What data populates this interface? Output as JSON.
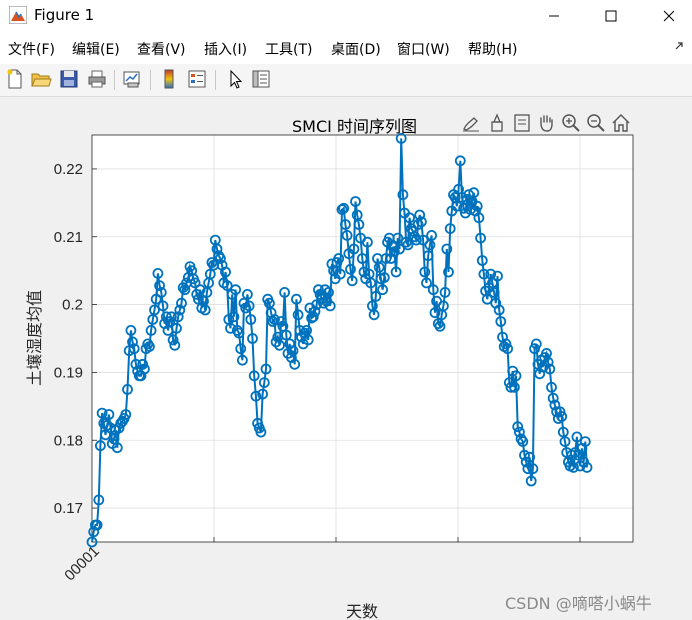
{
  "window": {
    "title": "Figure 1",
    "minimize_label": "—",
    "maximize_label": "☐",
    "close_label": "✕"
  },
  "menu": [
    {
      "label": "文件(F)"
    },
    {
      "label": "编辑(E)"
    },
    {
      "label": "查看(V)"
    },
    {
      "label": "插入(I)"
    },
    {
      "label": "工具(T)"
    },
    {
      "label": "桌面(D)"
    },
    {
      "label": "窗口(W)"
    },
    {
      "label": "帮助(H)"
    }
  ],
  "toolbar_icons": [
    "new-figure-icon",
    "open-file-icon",
    "save-icon",
    "print-icon",
    "link-plot-icon",
    "insert-colorbar-icon",
    "insert-legend-icon",
    "edit-plot-arrow-icon",
    "property-editor-icon"
  ],
  "axes_toolbar_icons": [
    "brush-icon",
    "data-tips-icon",
    "export-icon",
    "pan-hand-icon",
    "zoom-in-icon",
    "zoom-out-icon",
    "home-icon"
  ],
  "watermark": "CSDN @嘀嗒小蜗牛",
  "colors": {
    "series": "#0072BD",
    "axes_bg": "#ffffff",
    "figure_bg": "#f0f0f0",
    "grid": "#dfdfdf"
  },
  "chart_data": {
    "type": "line",
    "title": "SMCI 时间序列图",
    "xlabel": "天数",
    "ylabel": "土壤湿度均值",
    "x_tick_labels": [
      "00001"
    ],
    "ylim": [
      0.165,
      0.225
    ],
    "yticks": [
      0.17,
      0.18,
      0.19,
      0.2,
      0.21,
      0.22
    ],
    "ytick_labels": [
      "0.17",
      "0.18",
      "0.19",
      "0.2",
      "0.21",
      "0.22"
    ],
    "grid": true,
    "marker": "circle",
    "series": [
      {
        "values": [
          0.165,
          0.1665,
          0.1675,
          0.1675,
          0.1712,
          0.1792,
          0.184,
          0.1825,
          0.1808,
          0.1822,
          0.1838,
          0.1818,
          0.1795,
          0.1802,
          0.1815,
          0.1789,
          0.1818,
          0.1825,
          0.1828,
          0.1832,
          0.1838,
          0.1875,
          0.1932,
          0.1962,
          0.1945,
          0.1935,
          0.1912,
          0.1902,
          0.1895,
          0.1895,
          0.1912,
          0.1905,
          0.1935,
          0.1942,
          0.1938,
          0.1962,
          0.1978,
          0.1992,
          0.2008,
          0.2046,
          0.2028,
          0.2018,
          0.1998,
          0.1972,
          0.1982,
          0.1962,
          0.1975,
          0.1982,
          0.1948,
          0.194,
          0.1965,
          0.1982,
          0.1992,
          0.2002,
          0.2025,
          0.2022,
          0.2032,
          0.204,
          0.2056,
          0.205,
          0.2038,
          0.2032,
          0.2015,
          0.2008,
          0.2022,
          0.1995,
          0.2005,
          0.1992,
          0.2018,
          0.2032,
          0.2045,
          0.2062,
          0.2058,
          0.2095,
          0.2082,
          0.2072,
          0.2068,
          0.2058,
          0.2032,
          0.2048,
          0.2028,
          0.1978,
          0.1965,
          0.2015,
          0.1982,
          0.2022,
          0.1962,
          0.1958,
          0.1935,
          0.1918,
          0.2002,
          0.1995,
          0.2015,
          0.1998,
          0.1978,
          0.195,
          0.1895,
          0.1865,
          0.1825,
          0.1818,
          0.1812,
          0.1868,
          0.1885,
          0.1905,
          0.2008,
          0.2002,
          0.1988,
          0.1975,
          0.1978,
          0.1945,
          0.1952,
          0.194,
          0.1975,
          0.1968,
          0.2018,
          0.1955,
          0.1928,
          0.1942,
          0.1922,
          0.1932,
          0.1912,
          0.2008,
          0.1985,
          0.1962,
          0.1952,
          0.1942,
          0.1958,
          0.1962,
          0.1948,
          0.1995,
          0.198,
          0.1982,
          0.199,
          0.2,
          0.2022,
          0.2015,
          0.2008,
          0.2002,
          0.2022,
          0.2005,
          0.2018,
          0.1998,
          0.206,
          0.205,
          0.2038,
          0.2062,
          0.2068,
          0.2045,
          0.214,
          0.2142,
          0.2118,
          0.2102,
          0.2075,
          0.2052,
          0.2035,
          0.2082,
          0.2152,
          0.2132,
          0.2118,
          0.2098,
          0.2068,
          0.2048,
          0.2038,
          0.2092,
          0.2045,
          0.2032,
          0.1998,
          0.1985,
          0.2012,
          0.2068,
          0.2055,
          0.2038,
          0.2022,
          0.204,
          0.2068,
          0.2092,
          0.2098,
          0.2068,
          0.2085,
          0.2078,
          0.2048,
          0.2098,
          0.2082,
          0.2245,
          0.2162,
          0.2135,
          0.2092,
          0.2088,
          0.2128,
          0.2112,
          0.2108,
          0.21,
          0.2095,
          0.2118,
          0.2132,
          0.2122,
          0.2095,
          0.2048,
          0.2032,
          0.2072,
          0.2088,
          0.2102,
          0.2022,
          0.1988,
          0.2005,
          0.1972,
          0.1968,
          0.1985,
          0.1998,
          0.2018,
          0.2082,
          0.2048,
          0.2112,
          0.2138,
          0.2162,
          0.2158,
          0.2145,
          0.217,
          0.2212,
          0.2158,
          0.2142,
          0.2135,
          0.2155,
          0.2162,
          0.214,
          0.2152,
          0.2165,
          0.2138,
          0.2145,
          0.2128,
          0.2098,
          0.2065,
          0.2045,
          0.202,
          0.2008,
          0.2025,
          0.2045,
          0.2032,
          0.2018,
          0.2002,
          0.2042,
          0.1992,
          0.1975,
          0.1952,
          0.1938,
          0.1942,
          0.1935,
          0.1885,
          0.1878,
          0.1902,
          0.1878,
          0.1895,
          0.182,
          0.1812,
          0.1802,
          0.1798,
          0.1778,
          0.1768,
          0.1758,
          0.1775,
          0.174,
          0.1758,
          0.1935,
          0.1942,
          0.1912,
          0.1898,
          0.1918,
          0.1908,
          0.1922,
          0.1928,
          0.1915,
          0.1905,
          0.1878,
          0.1862,
          0.1852,
          0.1842,
          0.1832,
          0.1842,
          0.1835,
          0.1812,
          0.1798,
          0.1782,
          0.1768,
          0.1762,
          0.1778,
          0.176,
          0.1782,
          0.1805,
          0.1778,
          0.1762,
          0.1788,
          0.1768,
          0.1798,
          0.176
        ]
      }
    ]
  }
}
